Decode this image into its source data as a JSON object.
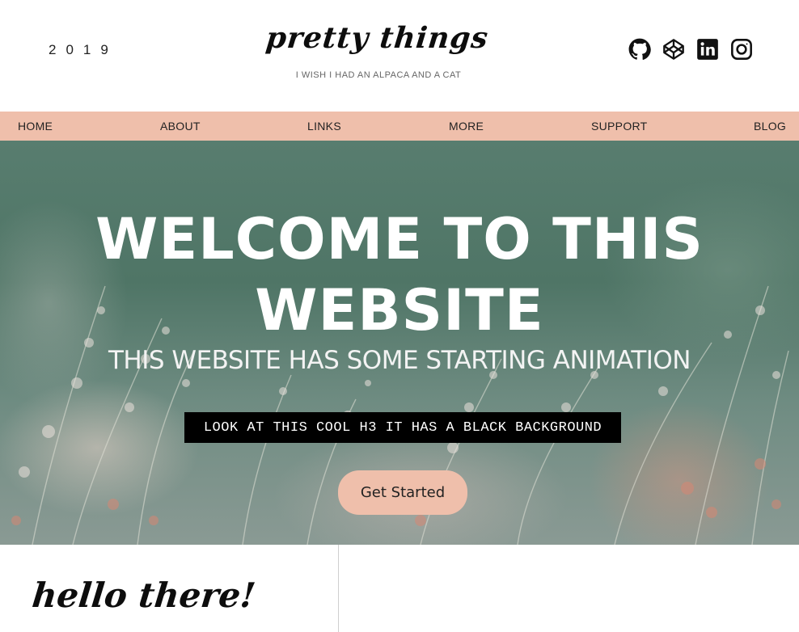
{
  "header": {
    "year": "2019",
    "brand": "pretty things",
    "tagline": "I WISH I HAD AN ALPACA AND A CAT",
    "socials": [
      {
        "icon": "github-icon"
      },
      {
        "icon": "codepen-icon"
      },
      {
        "icon": "linkedin-icon"
      },
      {
        "icon": "instagram-icon"
      }
    ]
  },
  "nav": {
    "items": [
      {
        "label": "HOME"
      },
      {
        "label": "ABOUT"
      },
      {
        "label": "LINKS"
      },
      {
        "label": "MORE"
      },
      {
        "label": "SUPPORT"
      },
      {
        "label": "BLOG"
      }
    ],
    "background": "#efbfab"
  },
  "hero": {
    "title_line1": "WELCOME TO THIS",
    "title_line2": "WEBSITE",
    "subtitle": "THIS WEBSITE HAS SOME STARTING ANIMATION",
    "h3": "LOOK AT THIS COOL H3 IT HAS A BLACK BACKGROUND",
    "cta_label": "Get Started"
  },
  "section": {
    "heading": "hello there!"
  },
  "colors": {
    "accent": "#efbfab",
    "text": "#111111"
  }
}
